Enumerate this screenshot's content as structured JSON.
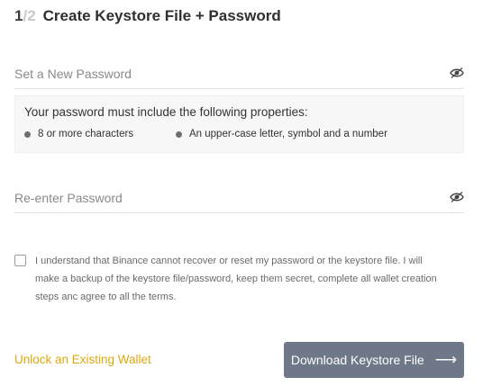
{
  "header": {
    "step_current": "1",
    "step_total": "/2",
    "title": "Create Keystore File + Password"
  },
  "new_password": {
    "placeholder": "Set a New Password",
    "value": "",
    "visibility_icon": "eye-icon"
  },
  "requirements": {
    "title": "Your password must include the following properties:",
    "items": [
      "8 or more characters",
      "An upper-case letter, symbol and a number"
    ],
    "bullet_color": "#6d6d6d"
  },
  "confirm_password": {
    "placeholder": "Re-enter Password",
    "value": "",
    "visibility_icon": "eye-icon"
  },
  "consent": {
    "checked": false,
    "text": "I understand that Binance cannot recover or reset my password or the keystore file. I will make a backup of the keystore file/password, keep them secret, complete all wallet creation steps anc agree to all the terms."
  },
  "actions": {
    "unlock_label": "Unlock an Existing Wallet",
    "download_label": "Download Keystore File",
    "download_arrow": "⟶"
  },
  "colors": {
    "accent_link": "#e0a80f",
    "button_bg": "#6e7888",
    "background": "#ffffff"
  }
}
